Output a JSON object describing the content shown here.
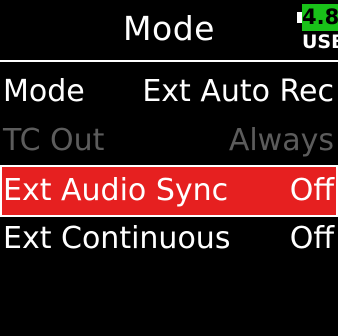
{
  "header": {
    "title": "Mode",
    "battery": {
      "level": "4.8",
      "source": "USB",
      "color": "#19c219"
    }
  },
  "menu": {
    "items": [
      {
        "label": "Mode",
        "value": "Ext Auto Rec",
        "state": "normal"
      },
      {
        "label": "TC Out",
        "value": "Always",
        "state": "disabled"
      },
      {
        "label": "Ext Audio Sync",
        "value": "Off",
        "state": "selected"
      },
      {
        "label": "Ext Continuous",
        "value": "Off",
        "state": "normal"
      }
    ]
  },
  "colors": {
    "selection": "#e62020",
    "disabled_text": "#5c5c5c",
    "background": "#000000"
  }
}
